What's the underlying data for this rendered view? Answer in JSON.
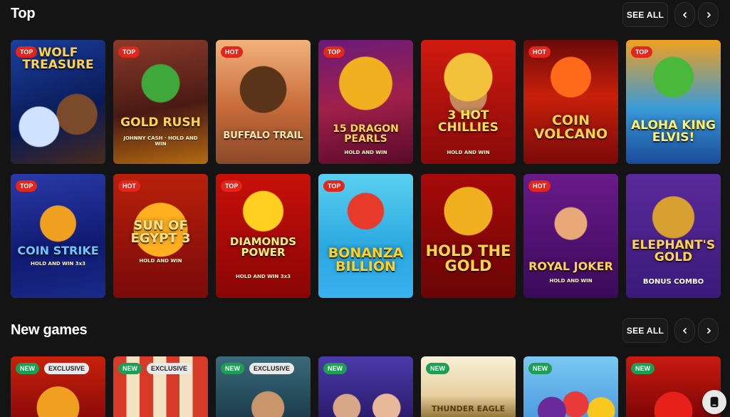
{
  "sections": {
    "top": {
      "title": "Top",
      "see_all": "SEE ALL",
      "row1": [
        {
          "badge": "TOP",
          "title": "Wolf Treasure",
          "sub": ""
        },
        {
          "badge": "TOP",
          "title": "Gold Rush",
          "sub": "JOHNNY CASH · HOLD AND WIN"
        },
        {
          "badge": "HOT",
          "title": "Buffalo Trail",
          "sub": ""
        },
        {
          "badge": "TOP",
          "title": "15 Dragon Pearls",
          "sub": "HOLD AND WIN"
        },
        {
          "badge": "",
          "title": "3 Hot Chillies",
          "sub": "HOLD AND WIN"
        },
        {
          "badge": "HOT",
          "title": "Coin Volcano",
          "sub": ""
        },
        {
          "badge": "TOP",
          "title": "Aloha King Elvis!",
          "sub": ""
        }
      ],
      "row2": [
        {
          "badge": "TOP",
          "title": "Coin Strike",
          "sub": "HOLD AND WIN 3x3"
        },
        {
          "badge": "HOT",
          "title": "Sun of Egypt 3",
          "sub": "HOLD AND WIN"
        },
        {
          "badge": "TOP",
          "title": "Diamonds Power",
          "sub": "HOLD AND WIN 3x3"
        },
        {
          "badge": "TOP",
          "title": "Bonanza Billion",
          "sub": ""
        },
        {
          "badge": "",
          "title": "Hold the Gold",
          "sub": ""
        },
        {
          "badge": "HOT",
          "title": "Royal Joker",
          "sub": "HOLD AND WIN"
        },
        {
          "badge": "",
          "title": "Elephant's Gold",
          "sub": "BONUS COMBO"
        }
      ]
    },
    "new_games": {
      "title": "New games",
      "see_all": "SEE ALL",
      "row": [
        {
          "badge": "NEW",
          "excl": "EXCLUSIVE",
          "title": ""
        },
        {
          "badge": "NEW",
          "excl": "EXCLUSIVE",
          "title": ""
        },
        {
          "badge": "NEW",
          "excl": "EXCLUSIVE",
          "title": ""
        },
        {
          "badge": "NEW",
          "excl": "",
          "title": ""
        },
        {
          "badge": "NEW",
          "excl": "",
          "title": "Thunder Eagle"
        },
        {
          "badge": "NEW",
          "excl": "",
          "title": ""
        },
        {
          "badge": "NEW",
          "excl": "",
          "title": ""
        }
      ]
    }
  },
  "colors": {
    "hot_badge": "#e1261c",
    "new_badge": "#1f9d55",
    "background": "#141414"
  },
  "icons": {
    "prev": "chevron-left-icon",
    "next": "chevron-right-icon",
    "chat": "chat-icon"
  }
}
